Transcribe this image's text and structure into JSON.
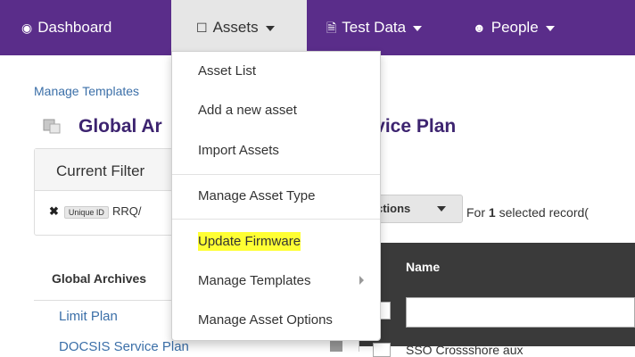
{
  "nav": {
    "items": [
      {
        "icon": "dashboard-icon",
        "label": "Dashboard"
      },
      {
        "icon": "square-icon",
        "label": "Assets"
      },
      {
        "icon": "document-icon",
        "label": "Test Data"
      },
      {
        "icon": "people-icon",
        "label": "People"
      }
    ]
  },
  "breadcrumb": "Manage Templates",
  "page": {
    "title_left": "Global Ar",
    "title_right": "rvice Plan"
  },
  "filter": {
    "title": "Current Filter",
    "tag": "Unique ID",
    "value": "RRQ/"
  },
  "actions": {
    "label": "ctions",
    "selected_prefix": "For ",
    "selected_count": "1",
    "selected_suffix": " selected record("
  },
  "sidebar": {
    "title": "Global Archives",
    "items": [
      "Limit Plan",
      "DOCSIS Service Plan"
    ]
  },
  "table": {
    "header_name": "Name",
    "first_row": "SSO Crossshore aux"
  },
  "assets_menu": {
    "items": [
      {
        "label": "Asset List"
      },
      {
        "label": "Add a new asset"
      },
      {
        "label": "Import Assets"
      },
      {
        "label": "Manage Asset Type"
      },
      {
        "label": "Update Firmware"
      },
      {
        "label": "Manage Templates"
      },
      {
        "label": "Manage Asset Options"
      }
    ]
  },
  "colors": {
    "nav_background": "#5a2d8a",
    "highlight": "#ffff33",
    "title": "#3d2470",
    "link": "#3b6fa8"
  }
}
